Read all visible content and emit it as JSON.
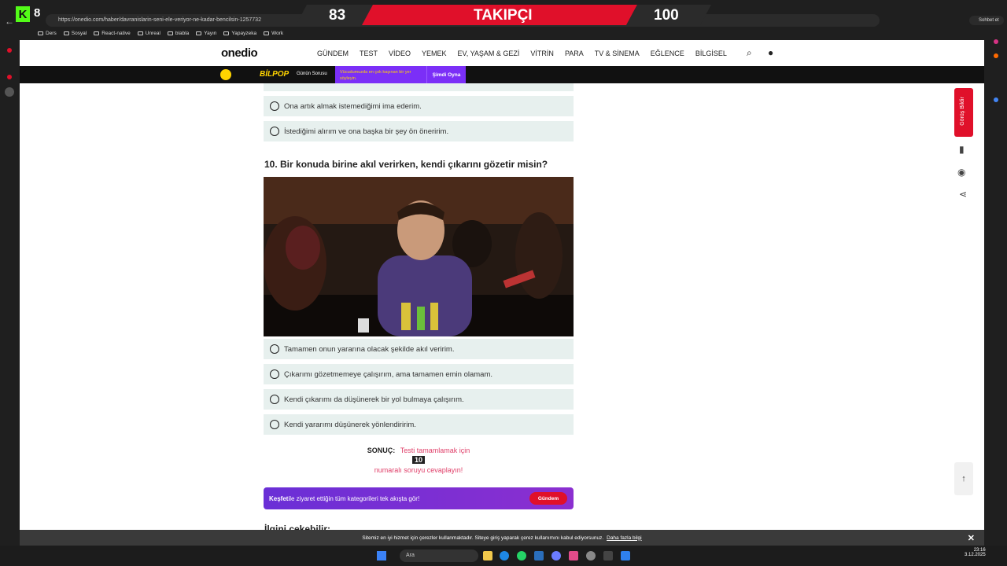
{
  "browser": {
    "url": "https://onedio.com/haber/davranislarin-seni-ele-veriyor-ne-kadar-bencilsin-1257732",
    "kick_count": "8",
    "chat_label": "Sohbet et",
    "bookmarks": [
      "Ders",
      "Sosyal",
      "React-native",
      "Unreal",
      "blabla",
      "Yayın",
      "Yapayzeka",
      "Work"
    ]
  },
  "overlay": {
    "left_count": "83",
    "label": "TAKIPÇI",
    "goal": "100"
  },
  "site": {
    "logo": "onedio",
    "menu": [
      "GÜNDEM",
      "TEST",
      "VİDEO",
      "YEMEK",
      "EV, YAŞAM & GEZİ",
      "VİTRİN",
      "PARA",
      "TV & SİNEMA",
      "EĞLENCE",
      "BİLGİSEL"
    ],
    "promo": {
      "brand": "BİLPOP",
      "sub": "Günün Sorusu",
      "text": "Vücudumuzda en çok kaşınan bir yer söyleyin.",
      "cta": "Şimdi Oyna"
    },
    "side_feedback": "Görüş Bildir"
  },
  "quiz": {
    "prev_options": [
      "Ona artık almak istemediğimi ima ederim.",
      "İstediğimi alırım ve ona başka bir şey ön öneririm."
    ],
    "question": "10. Bir konuda birine akıl verirken, kendi çıkarını gözetir misin?",
    "options": [
      "Tamamen onun yararına olacak şekilde akıl veririm.",
      "Çıkarımı gözetmemeye çalışırım, ama tamamen emin olamam.",
      "Kendi çıkarımı da düşünerek bir yol bulmaya çalışırım.",
      "Kendi yararımı düşünerek yönlendiririm."
    ],
    "result_label": "SONUÇ:",
    "result_line1": "Testi tamamlamak için",
    "result_num": "10",
    "result_line2": "numaralı soruyu cevaplayın!"
  },
  "kesfet": {
    "bold": "Keşfet",
    "text": " ile ziyaret ettiğin tüm kategorileri tek akışta gör!",
    "button": "Gündem"
  },
  "related_title": "İlgini çekebilir:",
  "cookie": {
    "text": "Sitemiz en iyi hizmet için çerezler kullanmaktadır. Siteye giriş yaparak çerez kullanımını kabul ediyorsunuz.",
    "link": "Daha fazla bilgi"
  },
  "taskbar": {
    "search": "Ara",
    "time": "23:16",
    "date": "3.12.2025"
  },
  "colors": {
    "accent": "#e0102a",
    "purple": "#7b2ff7",
    "option_bg": "#e7f0ee"
  }
}
